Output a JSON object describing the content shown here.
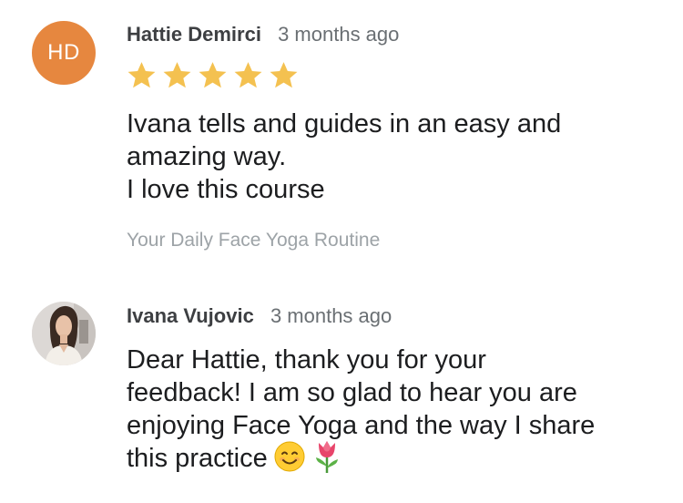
{
  "review": {
    "author_initials": "HD",
    "author_name": "Hattie Demirci",
    "timestamp": "3 months ago",
    "rating": 5,
    "rating_max": 5,
    "star_color": "#f4c150",
    "avatar_color": "#e6873f",
    "text_lines": [
      "Ivana tells and guides in an easy and",
      "amazing way.",
      "I love this course"
    ],
    "course_name": "Your Daily Face Yoga Routine"
  },
  "reply": {
    "author_name": "Ivana Vujovic",
    "timestamp": "3 months ago",
    "avatar_icon": "instructor-photo",
    "text_lines": [
      "Dear Hattie, thank you for your",
      "feedback! I am so glad to hear you are",
      "enjoying Face Yoga and the way I share",
      "this practice"
    ],
    "emojis": [
      "smiling-face-emoji",
      "tulip-emoji"
    ]
  }
}
